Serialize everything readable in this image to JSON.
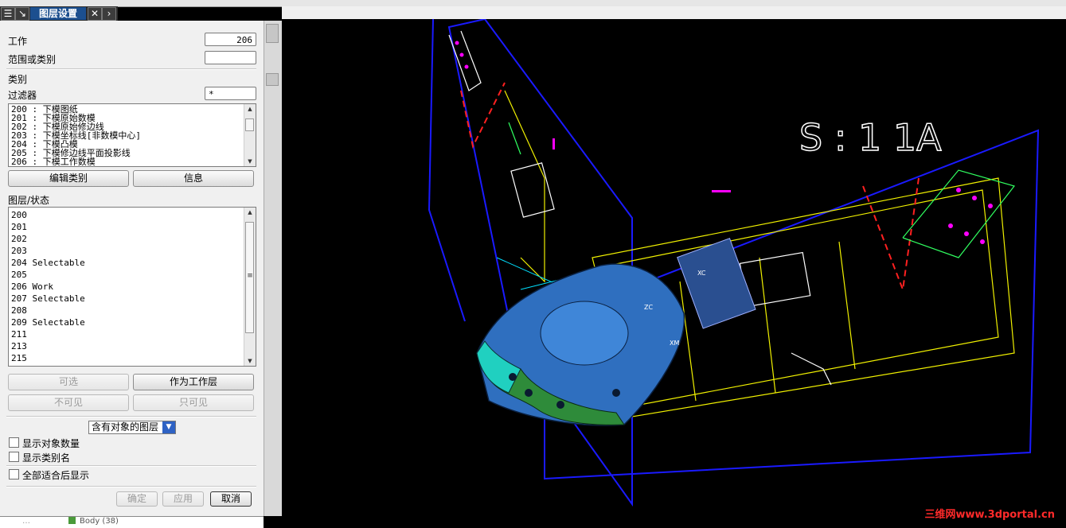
{
  "dialog": {
    "title": "图层设置",
    "work_label": "工作",
    "work_value": "206",
    "range_label": "范围或类别",
    "range_value": "",
    "category_label": "类别",
    "filter_label": "过滤器",
    "filter_value": "*",
    "categories": [
      "200 : 下模图纸",
      "201 : 下模原始数模",
      "202 : 下模原始修边线",
      "203 : 下模坐标线[非数模中心]",
      "204 : 下模凸模",
      "205 : 下模修边线平面投影线",
      "206 : 下模工作数模"
    ],
    "edit_category_button": "编辑类别",
    "info_button": "信息",
    "layer_status_label": "图层/状态",
    "layers": [
      "200",
      "201",
      "202",
      "203",
      "204 Selectable",
      "205",
      "206 Work",
      "207 Selectable",
      "208",
      "209 Selectable",
      "211",
      "213",
      "215"
    ],
    "selectable_button": "可选",
    "make_work_button": "作为工作层",
    "invisible_button": "不可见",
    "visible_only_button": "只可见",
    "layer_filter_option": "含有对象的图层",
    "show_object_count": "显示对象数量",
    "show_category_names": "显示类别名",
    "fit_all_label": "全部适合后显示",
    "ok_button": "确定",
    "apply_button": "应用",
    "cancel_button": "取消"
  },
  "tree": {
    "node_text": "Body (38)"
  },
  "viewport": {
    "scale_text": "S : 1  1A",
    "axis_label_xc": "XC",
    "axis_label_zc": "ZC",
    "axis_label_xm": "XM",
    "watermark": "三维网www.3dportal.cn"
  },
  "colors": {
    "viewport_bg": "#000000",
    "title_accent": "#1c4f8f",
    "combo_arrow": "#2e62c4",
    "watermark": "#ff2a2a"
  }
}
